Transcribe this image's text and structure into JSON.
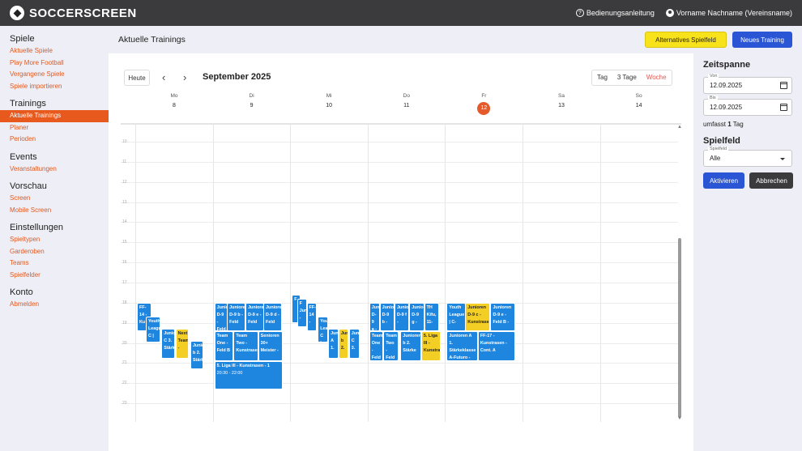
{
  "app": {
    "logo": "SOCCERSCREEN",
    "help": "Bedienungsanleitung",
    "user": "Vorname Nachname (Vereinsname)"
  },
  "sidebar": {
    "sections": [
      {
        "heading": "Spiele",
        "links": [
          "Aktuelle Spiele",
          "Play More Football",
          "Vergangene Spiele",
          "Spiele importieren"
        ]
      },
      {
        "heading": "Trainings",
        "links": [
          "Aktuelle Trainings",
          "Planer",
          "Perioden"
        ],
        "active": 0
      },
      {
        "heading": "Events",
        "links": [
          "Veranstaltungen"
        ]
      },
      {
        "heading": "Vorschau",
        "links": [
          "Screen",
          "Mobile Screen"
        ]
      },
      {
        "heading": "Einstellungen",
        "links": [
          "Spieltypen",
          "Garderoben",
          "Teams",
          "Spielfelder"
        ]
      },
      {
        "heading": "Konto",
        "links": [
          "Abmelden"
        ]
      }
    ]
  },
  "page": {
    "title": "Aktuelle Trainings",
    "btn_alt": "Alternatives Spielfeld",
    "btn_new": "Neues Training"
  },
  "calendar": {
    "today_btn": "Heute",
    "prev": "‹",
    "next": "›",
    "month": "September 2025",
    "views": [
      "Tag",
      "3 Tage",
      "Woche"
    ],
    "active_view": "Woche",
    "days": [
      {
        "name": "Mo",
        "num": "8"
      },
      {
        "name": "Di",
        "num": "9"
      },
      {
        "name": "Mi",
        "num": "10"
      },
      {
        "name": "Do",
        "num": "11"
      },
      {
        "name": "Fr",
        "num": "12",
        "today": true
      },
      {
        "name": "Sa",
        "num": "13"
      },
      {
        "name": "So",
        "num": "14"
      }
    ],
    "hours": [
      "10",
      "11",
      "12",
      "13",
      "14",
      "15",
      "16",
      "17",
      "18",
      "19",
      "20",
      "21",
      "22",
      "23"
    ],
    "events": [
      {
        "day": 0,
        "start": 18.0,
        "end": 19.4,
        "col": 0,
        "width": 0.2,
        "color": "blue",
        "text": "FF-14 - Ku"
      },
      {
        "day": 0,
        "start": 18.7,
        "end": 20.0,
        "col": 0.12,
        "width": 0.2,
        "color": "blue",
        "text": "Youth League C |"
      },
      {
        "day": 0,
        "start": 19.3,
        "end": 20.8,
        "col": 0.33,
        "width": 0.18,
        "color": "blue",
        "text": "Junioren C 3. Stärke"
      },
      {
        "day": 0,
        "start": 19.3,
        "end": 20.8,
        "col": 0.52,
        "width": 0.18,
        "color": "yellow",
        "text": "Next Team -"
      },
      {
        "day": 0,
        "start": 19.9,
        "end": 21.3,
        "col": 0.72,
        "width": 0.18,
        "color": "blue",
        "text": "Junioren b 2. Stärke"
      },
      {
        "day": 1,
        "start": 18.0,
        "end": 19.4,
        "col": 0,
        "width": 0.18,
        "color": "blue",
        "text": "Junioren D-9 - Feld"
      },
      {
        "day": 1,
        "start": 18.0,
        "end": 19.4,
        "col": 0.17,
        "width": 0.25,
        "color": "blue",
        "text": "Junioren D-9 b - Feld"
      },
      {
        "day": 1,
        "start": 18.0,
        "end": 19.4,
        "col": 0.42,
        "width": 0.25,
        "color": "blue",
        "text": "Junioren D-9 e - Feld"
      },
      {
        "day": 1,
        "start": 18.0,
        "end": 19.4,
        "col": 0.66,
        "width": 0.25,
        "color": "blue",
        "text": "Junioren D-9 d - Feld"
      },
      {
        "day": 1,
        "start": 19.4,
        "end": 20.9,
        "col": 0,
        "width": 0.26,
        "color": "blue",
        "text": "Team One - Feld B"
      },
      {
        "day": 1,
        "start": 19.4,
        "end": 20.9,
        "col": 0.26,
        "width": 0.33,
        "color": "blue",
        "text": "Team Two - Kunstrasen"
      },
      {
        "day": 1,
        "start": 19.4,
        "end": 20.9,
        "col": 0.59,
        "width": 0.33,
        "color": "blue",
        "text": "Senioren 30+ Meister -"
      },
      {
        "day": 1,
        "start": 20.9,
        "end": 22.3,
        "col": 0,
        "width": 0.92,
        "color": "blue",
        "text": "5. Liga III - Kunstrasen - 1",
        "time": "20:30 - 22:00"
      },
      {
        "day": 2,
        "start": 17.6,
        "end": 19.0,
        "col": 0,
        "width": 0.12,
        "color": "blue",
        "text": "F"
      },
      {
        "day": 2,
        "start": 17.8,
        "end": 19.2,
        "col": 0.07,
        "width": 0.13,
        "color": "blue",
        "text": "F Jun -"
      },
      {
        "day": 2,
        "start": 18.0,
        "end": 19.4,
        "col": 0.2,
        "width": 0.14,
        "color": "blue",
        "text": "FF-14 -"
      },
      {
        "day": 2,
        "start": 18.7,
        "end": 20.0,
        "col": 0.35,
        "width": 0.14,
        "color": "blue",
        "text": "Youth League C |"
      },
      {
        "day": 2,
        "start": 19.3,
        "end": 20.8,
        "col": 0.49,
        "width": 0.14,
        "color": "blue",
        "text": "Junioren A 1."
      },
      {
        "day": 2,
        "start": 19.3,
        "end": 20.8,
        "col": 0.63,
        "width": 0.13,
        "color": "yellow",
        "text": "Junioren b 2."
      },
      {
        "day": 2,
        "start": 19.3,
        "end": 20.8,
        "col": 0.77,
        "width": 0.14,
        "color": "blue",
        "text": "Junioren C 3."
      },
      {
        "day": 3,
        "start": 18.0,
        "end": 19.4,
        "col": 0,
        "width": 0.14,
        "color": "blue",
        "text": "Junioren D-9 a -"
      },
      {
        "day": 3,
        "start": 18.0,
        "end": 19.4,
        "col": 0.14,
        "width": 0.2,
        "color": "blue",
        "text": "Junioren D-9 b -"
      },
      {
        "day": 3,
        "start": 18.0,
        "end": 19.4,
        "col": 0.34,
        "width": 0.2,
        "color": "blue",
        "text": "Junioren D-9 f -"
      },
      {
        "day": 3,
        "start": 18.0,
        "end": 19.4,
        "col": 0.54,
        "width": 0.2,
        "color": "blue",
        "text": "Junioren D-9 g -"
      },
      {
        "day": 3,
        "start": 18.0,
        "end": 19.4,
        "col": 0.74,
        "width": 0.2,
        "color": "blue",
        "text": "TH Kifu, 11-"
      },
      {
        "day": 3,
        "start": 19.4,
        "end": 20.9,
        "col": 0,
        "width": 0.19,
        "color": "blue",
        "text": "Team One - Feld B"
      },
      {
        "day": 3,
        "start": 19.4,
        "end": 20.9,
        "col": 0.19,
        "width": 0.2,
        "color": "blue",
        "text": "Team Two - Feld B"
      },
      {
        "day": 3,
        "start": 19.4,
        "end": 20.9,
        "col": 0.42,
        "width": 0.28,
        "color": "blue",
        "text": "Junioren b 2. Stärke"
      },
      {
        "day": 3,
        "start": 19.4,
        "end": 20.9,
        "col": 0.7,
        "width": 0.26,
        "color": "yellow",
        "text": "5. Liga III - Kunstrasen"
      },
      {
        "day": 4,
        "start": 18.0,
        "end": 19.4,
        "col": 0,
        "width": 0.26,
        "color": "blue",
        "text": "Youth League | C-"
      },
      {
        "day": 4,
        "start": 18.0,
        "end": 19.4,
        "col": 0.25,
        "width": 0.34,
        "color": "yellow",
        "text": "Junioren D-9 c - Kunstrasen"
      },
      {
        "day": 4,
        "start": 18.0,
        "end": 19.4,
        "col": 0.59,
        "width": 0.33,
        "color": "blue",
        "text": "Junioren D-9 e - Feld B -"
      },
      {
        "day": 4,
        "start": 19.4,
        "end": 20.9,
        "col": 0,
        "width": 0.42,
        "color": "blue",
        "text": "Junioren A 1. Stärkeklasse A-Futuro -"
      },
      {
        "day": 4,
        "start": 19.4,
        "end": 20.9,
        "col": 0.42,
        "width": 0.5,
        "color": "blue",
        "text": "FF-17 - Kunstrasen - Cont. A"
      }
    ]
  },
  "right": {
    "zeitspanne": "Zeitspanne",
    "von_label": "Von",
    "von": "12.09.2025",
    "bis_label": "Bis",
    "bis": "12.09.2025",
    "umfasst_pre": "umfasst",
    "umfasst_num": "1",
    "umfasst_post": "Tag",
    "spielfeld": "Spielfeld",
    "spielfeld_label": "Spielfeld",
    "spielfeld_value": "Alle",
    "btn_activate": "Aktivieren",
    "btn_cancel": "Abbrechen"
  },
  "colors": {
    "accent": "#e8591e",
    "blue": "#1f86e0",
    "yellow": "#f3cf26",
    "primary": "#2a56d6"
  }
}
